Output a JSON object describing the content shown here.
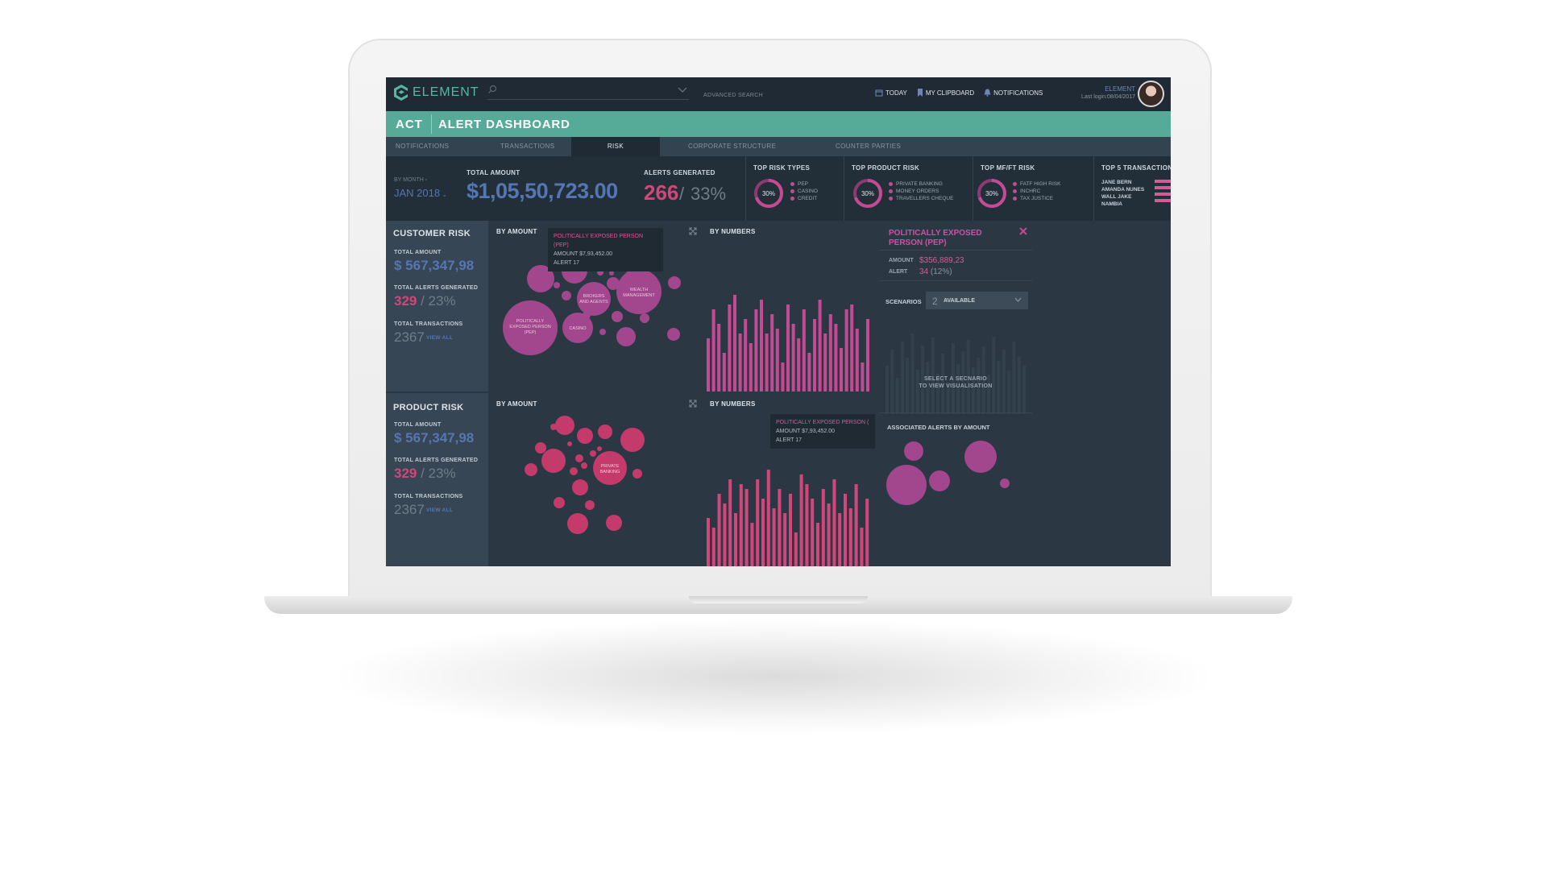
{
  "app": {
    "logo": "ELEMENT",
    "search_placeholder": "",
    "advanced_search": "ADVANCED SEARCH",
    "top_links": [
      "TODAY",
      "MY CLIPBOARD",
      "NOTIFICATIONS"
    ],
    "user_name": "ELEMENT",
    "last_login": "Last login:08/04/2017"
  },
  "titlebar": {
    "section": "ACT",
    "title": "ALERT DASHBOARD"
  },
  "tabs": [
    "NOTIFICATIONS",
    "TRANSACTIONS",
    "RISK",
    "CORPORATE STRUCTURE",
    "COUNTER PARTIES"
  ],
  "active_tab": "RISK",
  "stats": {
    "by_month_label": "BY MONTH",
    "month_value": "JAN 2018",
    "total_amount_label": "TOTAL AMOUNT",
    "total_amount": "$1,05,50,723.00",
    "alerts_label": "ALERTS GENERATED",
    "alerts_count": "266",
    "alerts_sep": "/",
    "alerts_pct": "33%",
    "top_risk_types": {
      "label": "TOP RISK TYPES",
      "pct": "30%",
      "items": [
        "PEP",
        "CASINO",
        "CREDIT"
      ]
    },
    "top_product_risk": {
      "label": "TOP PRODUCT RISK",
      "pct": "30%",
      "items": [
        "PRIVATE BANKING",
        "MONEY ORDERS",
        "TRAVELLERS CHEQUE"
      ]
    },
    "top_mfft_risk": {
      "label": "TOP MF/FT RISK",
      "pct": "30%",
      "items": [
        "FATF HIGH RISK",
        "INCHRC",
        "TAX JUSTICE"
      ]
    },
    "top5": {
      "label": "TOP 5 TRANSACTION",
      "names": [
        "JANE BERN",
        "AMANDA NUNES",
        "WALL JAKE",
        "NAMBIA"
      ]
    }
  },
  "customer_risk": {
    "title": "CUSTOMER RISK",
    "total_amount_label": "TOTAL AMOUNT",
    "total_amount": "$ 567,347,98",
    "alerts_label": "TOTAL ALERTS GENERATED",
    "alerts": "329",
    "alerts_pct": "/ 23%",
    "tx_label": "TOTAL TRANSACTIONS",
    "tx": "2367",
    "view_all": "VIEW ALL"
  },
  "product_risk": {
    "title": "PRODUCT RISK",
    "total_amount_label": "TOTAL AMOUNT",
    "total_amount": "$ 567,347,98",
    "alerts_label": "TOTAL ALERTS GENERATED",
    "alerts": "329",
    "alerts_pct": "/ 23%",
    "tx_label": "TOTAL TRANSACTIONS",
    "tx": "2367",
    "view_all": "VIEW ALL"
  },
  "panels": {
    "by_amount_1": "BY AMOUNT",
    "by_numbers_1": "BY NUMBERS",
    "by_amount_2": "BY AMOUNT",
    "by_numbers_2": "BY NUMBERS"
  },
  "tooltip1": {
    "title": "POLITICALLY EXPOSED PERSON (PEP)",
    "amount": "AMOUNT $7,93,452.00",
    "alert": "ALERT 17"
  },
  "tooltip2": {
    "title": "POLITICALLY EXPOSED PERSON (",
    "amount": "AMOUNT $7,93,452.00",
    "alert": "ALERT 17"
  },
  "bubble_labels": {
    "pep": [
      "POLITICALLY",
      "EXPOSED PERSON",
      "(PEP)"
    ],
    "brokers": [
      "BROKERS",
      "AND AGENTS"
    ],
    "wealth": [
      "WEALTH",
      "MANAGEMENT"
    ],
    "casino": [
      "CASINO"
    ],
    "private": [
      "PRIVATE",
      "BANKING"
    ]
  },
  "pep_detail": {
    "title": "POLITICALLY EXPOSED PERSON (PEP)",
    "amount_label": "AMOUNT",
    "amount": "$356,889,23",
    "alert_label": "ALERT",
    "alert": "34",
    "alert_pct": "(12%)",
    "scenarios_label": "SCENARIOS",
    "scenarios_count": "2",
    "scenarios_value": "AVAILABLE",
    "select_msg_1": "SELECT A SECNARIO",
    "select_msg_2": "TO VIEW VISUALISATION",
    "assoc_label": "ASSOCIATED ALERTS BY AMOUNT"
  },
  "colors": {
    "accent": "#56aa98",
    "blue": "#5477b3",
    "magenta": "#c44a93",
    "pink": "#d2467a",
    "bg": "#2b3844"
  },
  "chart_data": [
    {
      "type": "bar",
      "values": [
        55,
        85,
        70,
        40,
        90,
        100,
        60,
        75,
        50,
        85,
        95,
        60,
        80,
        65,
        30,
        90,
        70,
        55,
        85,
        40,
        75,
        95,
        60,
        80,
        70,
        45,
        85,
        90,
        65,
        30,
        75
      ]
    },
    {
      "type": "bar",
      "values": [
        50,
        40,
        75,
        65,
        90,
        55,
        85,
        80,
        45,
        90,
        70,
        100,
        60,
        80,
        55,
        75,
        35,
        95,
        85,
        70,
        45,
        80,
        65,
        90,
        55,
        75,
        60,
        85,
        40,
        70
      ]
    }
  ]
}
